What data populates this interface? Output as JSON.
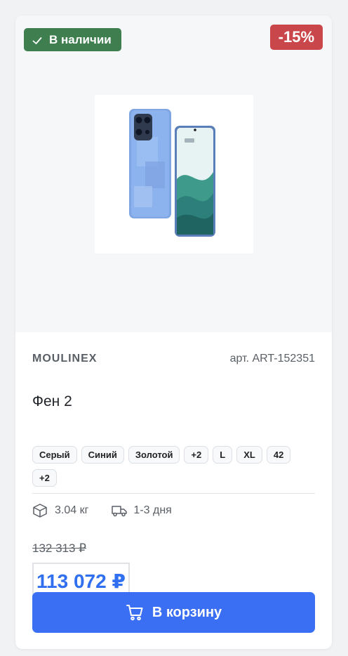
{
  "badges": {
    "stock_label": "В наличии",
    "discount_label": "-15%"
  },
  "product": {
    "brand": "MOULINEX",
    "sku": "арт. ART-152351",
    "title": "Фен 2",
    "tags": [
      "Серый",
      "Синий",
      "Золотой",
      "+2",
      "L",
      "XL",
      "42",
      "+2"
    ],
    "weight": "3.04 кг",
    "delivery": "1-3 дня",
    "old_price": "132 313 ₽",
    "price": "113 072 ₽"
  },
  "actions": {
    "cart_label": "В корзину"
  },
  "colors": {
    "stock_badge": "#3f7f4f",
    "discount_badge": "#c9474b",
    "price": "#2f6ff0",
    "cart_button": "#3a6ff3"
  },
  "icons": {
    "stock": "check-icon",
    "weight": "box-icon",
    "delivery": "truck-icon",
    "cart": "cart-icon"
  }
}
